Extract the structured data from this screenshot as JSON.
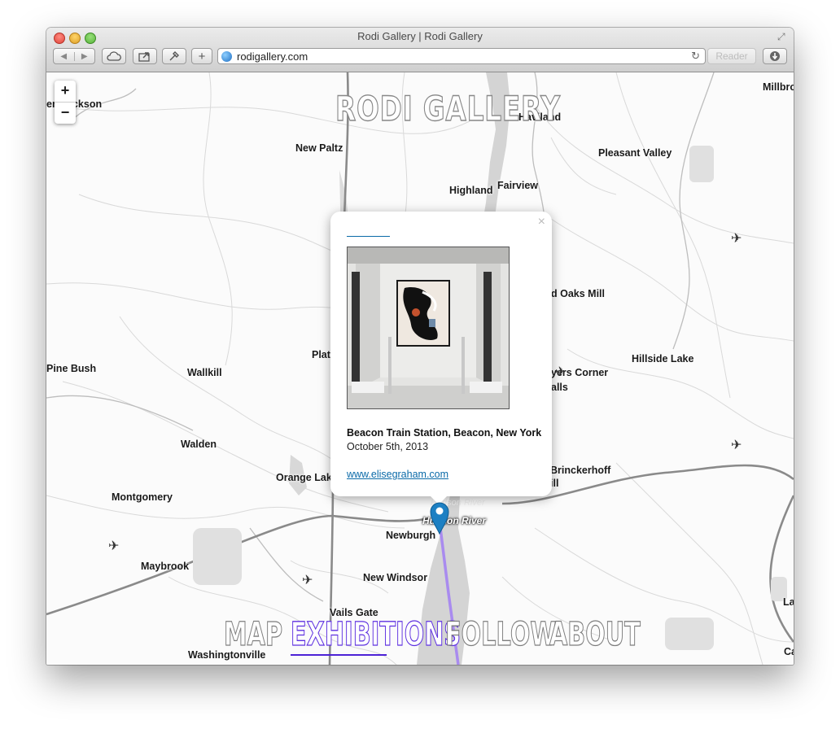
{
  "window": {
    "title": "Rodi Gallery | Rodi Gallery",
    "url": "rodigallery.com",
    "reader_label": "Reader",
    "back_label": "◀",
    "forward_label": "▶"
  },
  "site": {
    "title": "RODI GALLERY"
  },
  "zoom": {
    "in_label": "+",
    "out_label": "−"
  },
  "places": [
    "Millbro",
    "Haviland",
    "New Paltz",
    "Pleasant Valley",
    "Highland",
    "Fairview",
    "d Oaks Mill",
    "Hillside Lake",
    "Pine Bush",
    "Wallkill",
    "Plat",
    "yers Corner",
    "alls",
    "Walden",
    "Orange Lak",
    "Brinckerhoff",
    "ill",
    "Montgomery",
    "Newburgh",
    "Maybrook",
    "New Windsor",
    "Vails Gate",
    "Washingtonville",
    "La",
    "Ca",
    "en Jackson"
  ],
  "river_labels": [
    "Hudson River",
    "Hudson River"
  ],
  "popup": {
    "close_label": "×",
    "venue": "Beacon Train Station, Beacon, New York",
    "date": "October 5th, 2013",
    "link": "www.elisegraham.com"
  },
  "nav": {
    "items": [
      "MAP",
      "EXHIBITIONS",
      "FOLLOW",
      "ABOUT"
    ],
    "active": "EXHIBITIONS"
  },
  "colors": {
    "route": "#a98bef",
    "marker": "#1d80c3",
    "active_nav": "#5d2fe0",
    "link": "#0a6aa8",
    "water": "#d4d4d4"
  },
  "icons": [
    "airport-icon",
    "map-marker-icon",
    "globe-icon",
    "cloud-icon",
    "share-icon",
    "bookmark-icon",
    "add-icon",
    "reload-icon",
    "download-icon"
  ]
}
